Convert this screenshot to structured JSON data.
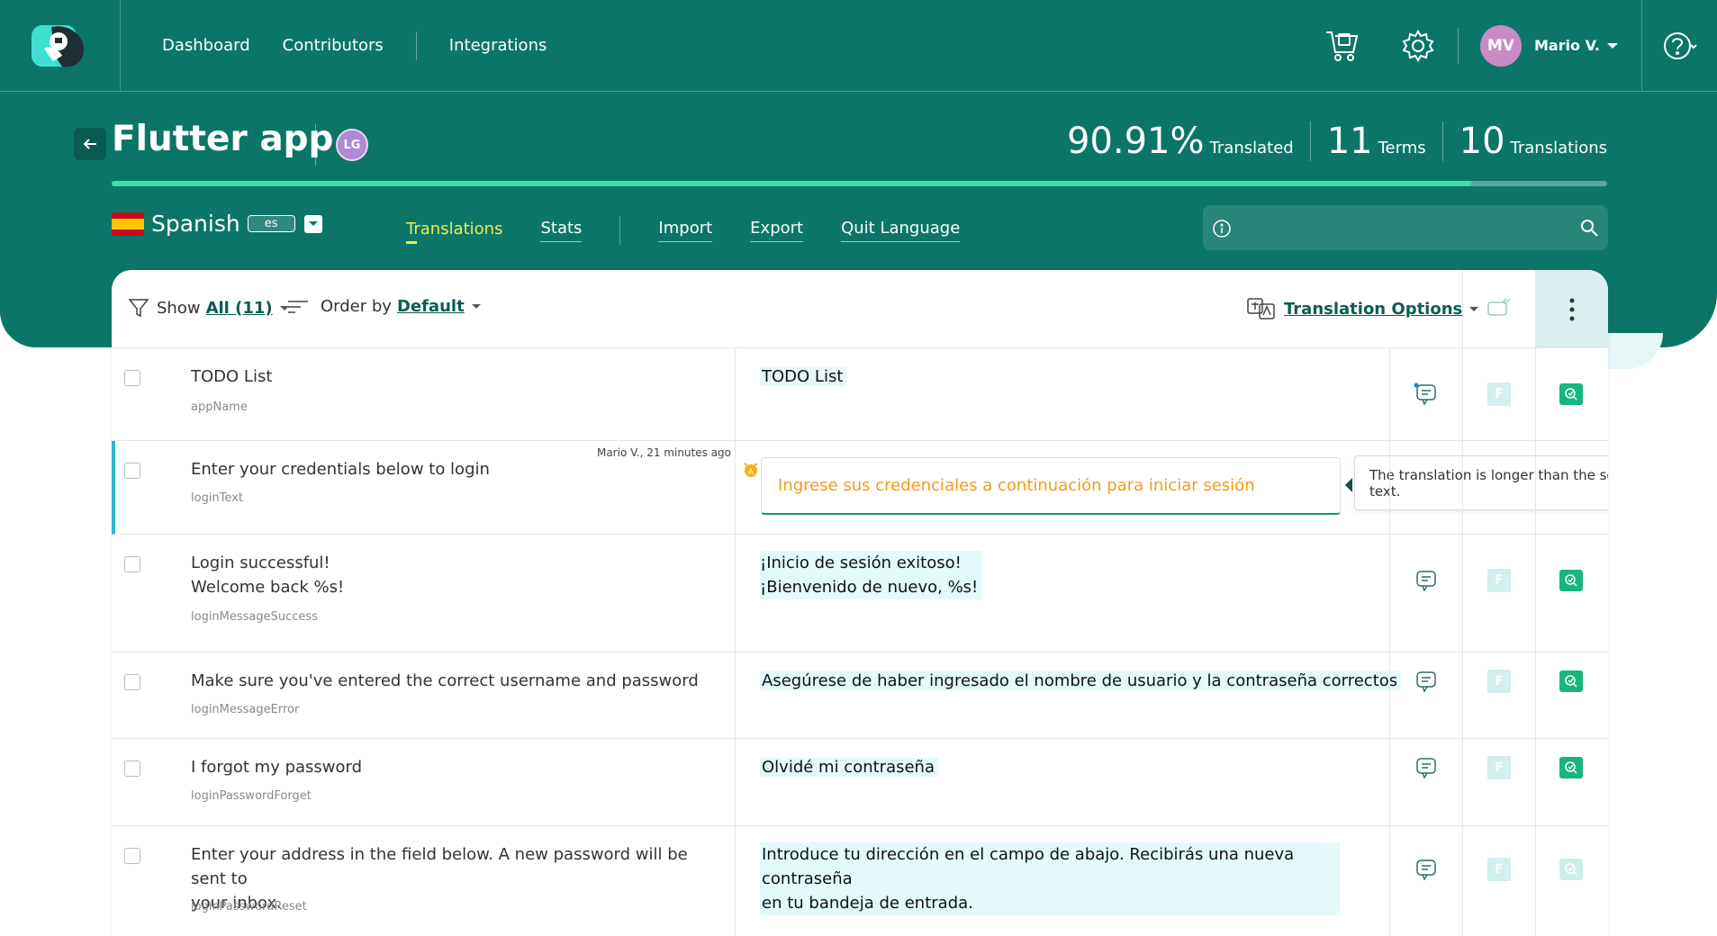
{
  "nav": {
    "links": [
      "Dashboard",
      "Contributors",
      "Integrations"
    ],
    "user": {
      "initials": "MV",
      "name": "Mario V."
    }
  },
  "project": {
    "title": "Flutter app",
    "owner_badge": "LG",
    "stats": {
      "translated_pct": "90.91%",
      "translated_label": "Translated",
      "terms": "11",
      "terms_label": "Terms",
      "translations": "10",
      "translations_label": "Translations"
    },
    "progress_fraction": 0.9091
  },
  "language": {
    "name": "Spanish",
    "code": "es"
  },
  "tabs": [
    "Translations",
    "Stats",
    "Import",
    "Export",
    "Quit Language"
  ],
  "toolbar": {
    "show_label": "Show",
    "show_value": "All (11)",
    "order_label": "Order by",
    "order_value": "Default",
    "translation_options": "Translation Options"
  },
  "rows": [
    {
      "source": "TODO List",
      "key": "appName",
      "translation": "TODO List"
    },
    {
      "source": "Enter your credentials below to login",
      "key": "loginText",
      "translation": "Ingrese sus credenciales a continuación para iniciar sesión",
      "meta": "Mario V., 21 minutes ago",
      "tooltip": "The translation is longer than the source text."
    },
    {
      "source_lines": [
        "Login successful!",
        "Welcome back %s!"
      ],
      "key": "loginMessageSuccess",
      "translation_lines": [
        "¡Inicio de sesión exitoso!",
        "¡Bienvenido de nuevo, %s!"
      ]
    },
    {
      "source": "Make sure you've entered the correct username and password",
      "key": "loginMessageError",
      "translation": "Asegúrese de haber ingresado el nombre de usuario y la contraseña correctos"
    },
    {
      "source": "I forgot my password",
      "key": "loginPasswordForget",
      "translation": "Olvidé mi contraseña"
    },
    {
      "source_lines": [
        "Enter your address in the field below. A new password will be sent to",
        "your inbox."
      ],
      "key": "loginPasswordReset",
      "translation_lines": [
        "Introduce tu dirección en el campo de abajo. Recibirás una nueva contraseña",
        "en tu bandeja de entrada."
      ]
    }
  ],
  "colors": {
    "brand": "#0b7667",
    "accent": "#3ee0a4",
    "warning": "#f39a1a",
    "verified": "#17b67c"
  }
}
